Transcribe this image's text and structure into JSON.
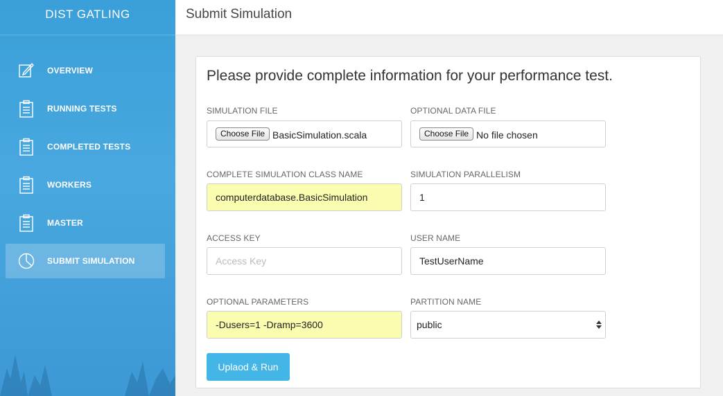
{
  "app": {
    "title": "DIST GATLING"
  },
  "sidebar": {
    "items": [
      {
        "label": "OVERVIEW",
        "icon": "edit-icon"
      },
      {
        "label": "RUNNING TESTS",
        "icon": "clipboard-icon"
      },
      {
        "label": "COMPLETED TESTS",
        "icon": "clipboard-icon"
      },
      {
        "label": "WORKERS",
        "icon": "clipboard-icon"
      },
      {
        "label": "MASTER",
        "icon": "clipboard-icon"
      },
      {
        "label": "SUBMIT SIMULATION",
        "icon": "pie-chart-icon",
        "active": true
      }
    ]
  },
  "header": {
    "title": "Submit Simulation"
  },
  "form": {
    "heading": "Please provide complete information for your performance test.",
    "simulation_file": {
      "label": "SIMULATION FILE",
      "button": "Choose File",
      "value": "BasicSimulation.scala"
    },
    "data_file": {
      "label": "OPTIONAL DATA FILE",
      "button": "Choose File",
      "value": "No file chosen"
    },
    "class_name": {
      "label": "COMPLETE SIMULATION CLASS NAME",
      "value": "computerdatabase.BasicSimulation"
    },
    "parallelism": {
      "label": "SIMULATION PARALLELISM",
      "value": "1"
    },
    "access_key": {
      "label": "ACCESS KEY",
      "value": "",
      "placeholder": "Access Key"
    },
    "user_name": {
      "label": "USER NAME",
      "value": "TestUserName"
    },
    "parameters": {
      "label": "OPTIONAL PARAMETERS",
      "value": "-Dusers=1 -Dramp=3600"
    },
    "partition": {
      "label": "PARTITION NAME",
      "selected": "public"
    },
    "submit_label": "Uplaod & Run"
  },
  "colors": {
    "sidebar": "#3a9fd9",
    "autofill_yellow": "#fafcb0",
    "button": "#43b5e6"
  }
}
